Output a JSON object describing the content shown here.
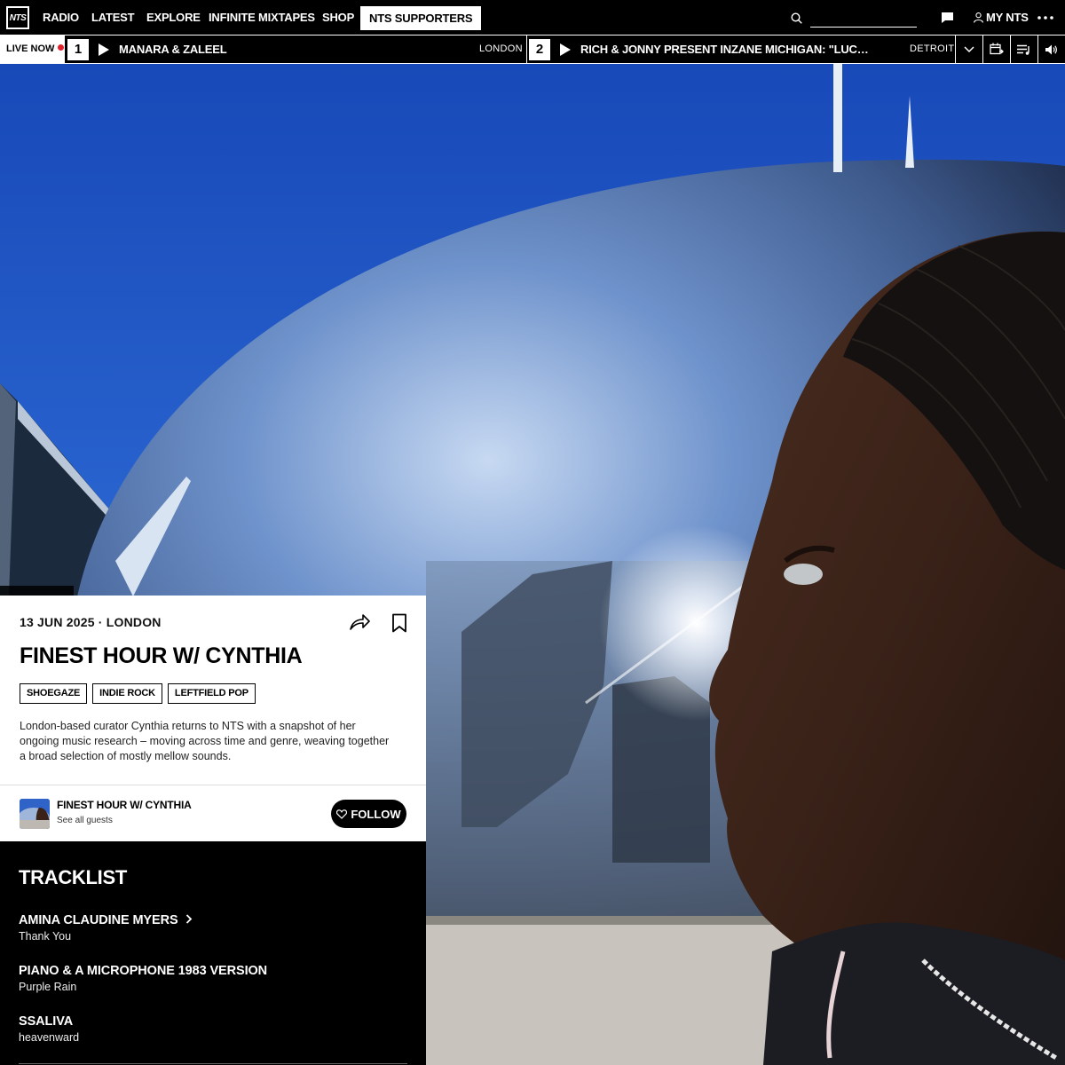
{
  "nav": {
    "logo": "NTS",
    "items": [
      "RADIO",
      "LATEST",
      "EXPLORE",
      "INFINITE MIXTAPES",
      "SHOP"
    ],
    "supporters": "NTS SUPPORTERS",
    "search_placeholder": "",
    "my_nts": "MY NTS",
    "icons": [
      "search-icon",
      "chat-icon",
      "user-icon",
      "more-icon"
    ]
  },
  "live": {
    "label": "LIVE NOW",
    "channels": [
      {
        "number": "1",
        "title": "MANARA & ZALEEL",
        "location": "LONDON"
      },
      {
        "number": "2",
        "title": "RICH & JONNY PRESENT INZANE MICHIGAN: \"LUCIFER'S…",
        "location": "DETROIT"
      }
    ],
    "controls": [
      "chevron-down-icon",
      "schedule-icon",
      "playlist-icon",
      "volume-icon"
    ],
    "accent": "#e0202a"
  },
  "episode": {
    "date": "13 JUN 2025",
    "location": "LONDON",
    "title": "FINEST HOUR W/ CYNTHIA",
    "tags": [
      "SHOEGAZE",
      "INDIE ROCK",
      "LEFTFIELD POP"
    ],
    "description": "London-based curator Cynthia returns to NTS with a snapshot of her ongoing music research – moving across time and genre, weaving together a broad selection of mostly mellow sounds."
  },
  "show": {
    "name": "FINEST HOUR W/ CYNTHIA",
    "sub": "See all guests",
    "follow": "FOLLOW"
  },
  "tracklist": {
    "heading": "TRACKLIST",
    "tracks": [
      {
        "artist": "AMINA CLAUDINE MYERS",
        "title": "Thank You"
      },
      {
        "artist": "PIANO & A MICROPHONE 1983 VERSION",
        "title": "Purple Rain"
      },
      {
        "artist": "SSALIVA",
        "title": "heavenward"
      }
    ]
  }
}
